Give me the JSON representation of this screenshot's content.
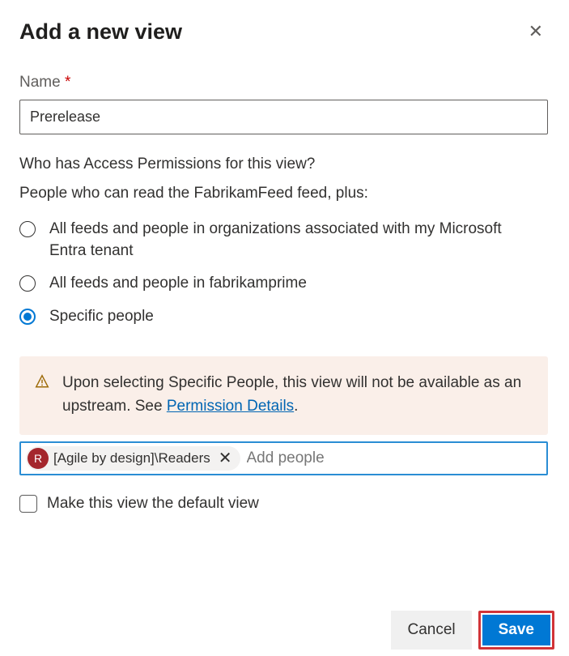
{
  "dialog": {
    "title": "Add a new view",
    "nameField": {
      "label": "Name",
      "required": "*",
      "value": "Prerelease"
    },
    "permissions": {
      "question": "Who has Access Permissions for this view?",
      "subtitle": "People who can read the FabrikamFeed feed, plus:",
      "options": [
        {
          "label": "All feeds and people in organizations associated with my Microsoft Entra tenant",
          "selected": false
        },
        {
          "label": "All feeds and people in fabrikamprime",
          "selected": false
        },
        {
          "label": "Specific people",
          "selected": true
        }
      ]
    },
    "notice": {
      "textPrefix": "Upon selecting Specific People, this view will not be available as an upstream. See ",
      "linkText": "Permission Details",
      "textSuffix": "."
    },
    "peopleInput": {
      "chip": {
        "initial": "R",
        "label": "[Agile by design]\\Readers"
      },
      "placeholder": "Add people"
    },
    "defaultCheckbox": {
      "label": "Make this view the default view",
      "checked": false
    },
    "buttons": {
      "cancel": "Cancel",
      "save": "Save"
    }
  }
}
